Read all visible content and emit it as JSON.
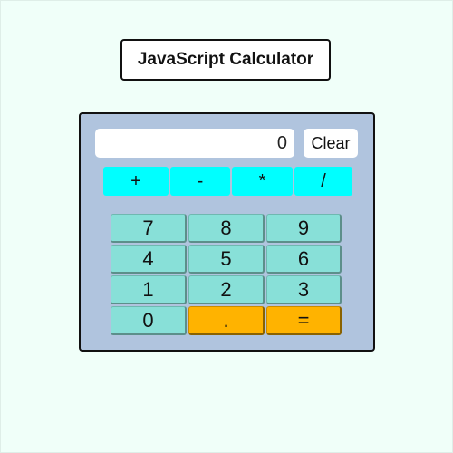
{
  "title": "JavaScript Calculator",
  "display": {
    "value": "0"
  },
  "clear_label": "Clear",
  "operators": [
    {
      "label": "+",
      "name": "plus"
    },
    {
      "label": "-",
      "name": "minus"
    },
    {
      "label": "*",
      "name": "multiply"
    },
    {
      "label": "/",
      "name": "divide"
    }
  ],
  "keys": [
    {
      "label": "7",
      "name": "7"
    },
    {
      "label": "8",
      "name": "8"
    },
    {
      "label": "9",
      "name": "9"
    },
    {
      "label": "4",
      "name": "4"
    },
    {
      "label": "5",
      "name": "5"
    },
    {
      "label": "6",
      "name": "6"
    },
    {
      "label": "1",
      "name": "1"
    },
    {
      "label": "2",
      "name": "2"
    },
    {
      "label": "3",
      "name": "3"
    },
    {
      "label": "0",
      "name": "0"
    },
    {
      "label": ".",
      "name": "decimal"
    },
    {
      "label": "=",
      "name": "equals"
    }
  ],
  "colors": {
    "page_background": "#f0fff9",
    "calculator_background": "#b0c4de",
    "operator_button": "#00ffff",
    "number_button": "#88e0d8",
    "accent_button": "#ffb300"
  }
}
